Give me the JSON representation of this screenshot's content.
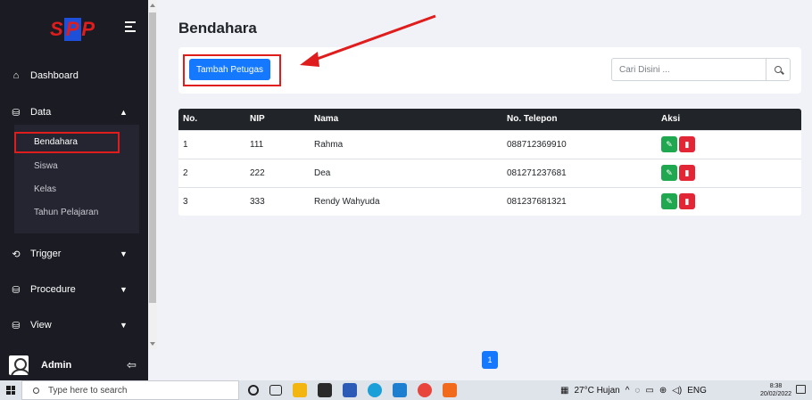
{
  "sidebar": {
    "logo": {
      "part1": "S",
      "part2": "P",
      "part3": "P"
    },
    "menu": [
      {
        "label": "Dashboard",
        "icon": "home-icon"
      },
      {
        "label": "Data",
        "icon": "database-icon"
      },
      {
        "label": "Trigger",
        "icon": "history-icon"
      },
      {
        "label": "Procedure",
        "icon": "database-icon"
      },
      {
        "label": "View",
        "icon": "database-icon"
      }
    ],
    "submenu": [
      "Bendahara",
      "Siswa",
      "Kelas",
      "Tahun Pelajaran"
    ],
    "user": {
      "name": "Admin"
    }
  },
  "main": {
    "title": "Bendahara",
    "add_button": "Tambah Petugas",
    "search_placeholder": "Cari Disini ...",
    "table": {
      "headers": [
        "No.",
        "NIP",
        "Nama",
        "No. Telepon",
        "Aksi"
      ],
      "rows": [
        {
          "no": "1",
          "nip": "111",
          "nama": "Rahma",
          "telepon": "088712369910"
        },
        {
          "no": "2",
          "nip": "222",
          "nama": "Dea",
          "telepon": "081271237681"
        },
        {
          "no": "3",
          "nip": "333",
          "nama": "Rendy Wahyuda",
          "telepon": "081237681321"
        }
      ]
    },
    "pagination": {
      "current": "1"
    }
  },
  "taskbar": {
    "search_placeholder": "Type here to search",
    "weather": "27°C  Hujan",
    "language": "ENG",
    "time": "8:38",
    "date": "20/02/2022"
  },
  "colors": {
    "primary": "#1479ff",
    "sidebar": "#1a1b23",
    "highlight": "#e01d1d",
    "edit": "#1fa84f",
    "delete": "#e32636"
  }
}
